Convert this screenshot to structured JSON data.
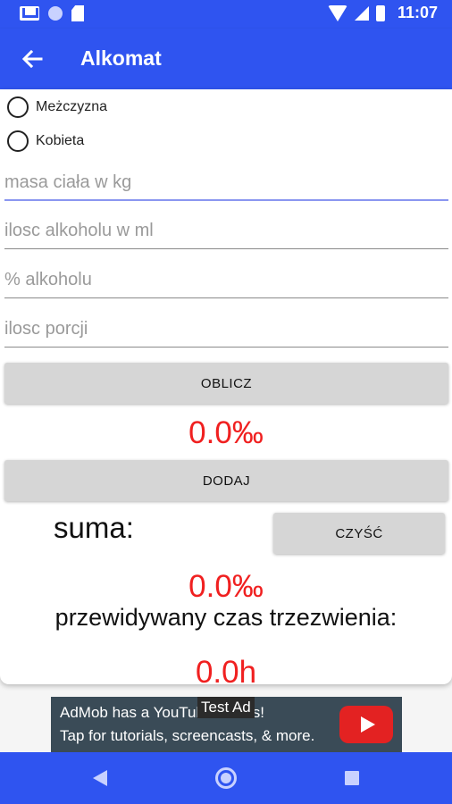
{
  "status_bar": {
    "time": "11:07",
    "icons": [
      "gmail-icon",
      "circle-icon",
      "sd-card-icon",
      "wifi-icon",
      "signal-icon",
      "battery-icon"
    ]
  },
  "app_bar": {
    "title": "Alkomat",
    "back_icon": "arrow-left-icon"
  },
  "gender": {
    "options": [
      "Meżczyzna",
      "Kobieta"
    ]
  },
  "fields": {
    "mass_placeholder": "masa ciała w kg",
    "amount_placeholder": "ilosc alkoholu w ml",
    "percent_placeholder": "% alkoholu",
    "portions_placeholder": "ilosc porcji"
  },
  "buttons": {
    "calculate": "OBLICZ",
    "add": "DODAJ",
    "clear": "CZYŚĆ"
  },
  "results": {
    "current": "0.0‰",
    "sum_label": "suma:",
    "sum_value": "0.0‰",
    "sober_label": "przewidywany czas trzezwienia:",
    "sober_value": "0.0h"
  },
  "ad": {
    "badge": "Test Ad",
    "line1": "AdMob has a YouTube Series!",
    "line2": "Tap for tutorials, screencasts, & more.",
    "icon": "youtube-icon"
  },
  "colors": {
    "primary": "#2f54f0",
    "result_red": "#f02020",
    "button_gray": "#d6d6d6"
  }
}
